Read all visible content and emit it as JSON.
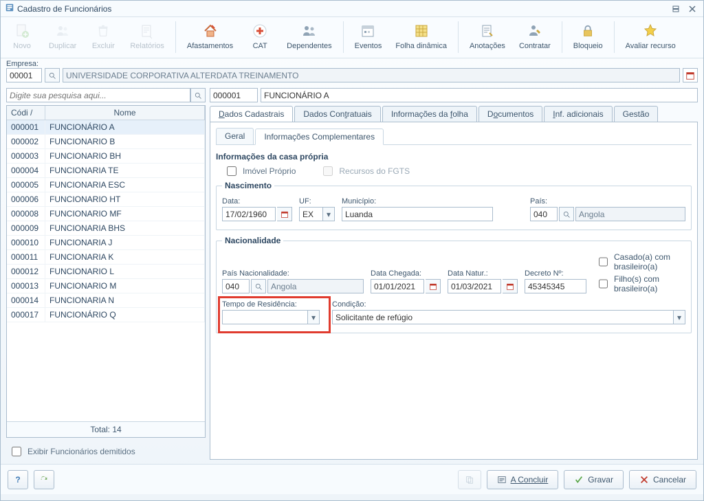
{
  "window": {
    "title": "Cadastro de Funcionários"
  },
  "toolbar": {
    "novo": "Novo",
    "duplicar": "Duplicar",
    "excluir": "Excluir",
    "relatorios": "Relatórios",
    "afastamentos": "Afastamentos",
    "cat": "CAT",
    "dependentes": "Dependentes",
    "eventos": "Eventos",
    "folha": "Folha dinâmica",
    "anotacoes": "Anotações",
    "contratar": "Contratar",
    "bloqueio": "Bloqueio",
    "avaliar": "Avaliar recurso"
  },
  "empresa": {
    "label": "Empresa:",
    "code": "00001",
    "name": "UNIVERSIDADE CORPORATIVA ALTERDATA TREINAMENTO"
  },
  "search": {
    "placeholder": "Digite sua pesquisa aqui..."
  },
  "grid": {
    "headers": {
      "codigo": "Códi  /",
      "nome": "Nome"
    },
    "rows": [
      {
        "c": "000001",
        "n": "FUNCIONÁRIO A",
        "sel": true
      },
      {
        "c": "000002",
        "n": "FUNCIONARIO B"
      },
      {
        "c": "000003",
        "n": "FUNCIONARIO BH"
      },
      {
        "c": "000004",
        "n": "FUNCIONARIA TE"
      },
      {
        "c": "000005",
        "n": "FUNCIONARIA ESC"
      },
      {
        "c": "000006",
        "n": "FUNCIONARIO HT"
      },
      {
        "c": "000008",
        "n": "FUNCIONARIO MF"
      },
      {
        "c": "000009",
        "n": "FUNCIONARIA BHS"
      },
      {
        "c": "000010",
        "n": "FUNCIONARIA J"
      },
      {
        "c": "000011",
        "n": "FUNCIONARIA K"
      },
      {
        "c": "000012",
        "n": "FUNCIONARIO L"
      },
      {
        "c": "000013",
        "n": "FUNCIONARIO M"
      },
      {
        "c": "000014",
        "n": "FUNCIONARIA N"
      },
      {
        "c": "000017",
        "n": "FUNCIONÁRIO Q"
      }
    ],
    "total": "Total: 14"
  },
  "left": {
    "exibir_demitidos": "Exibir Funcionários demitidos"
  },
  "right": {
    "code": "000001",
    "name": "FUNCIONÁRIO A",
    "tabs": {
      "cadastrais": "Dados Cadastrais",
      "contratuais": "Dados Contratuais",
      "folha": "Informações da folha",
      "docs": "Documentos",
      "inf": "Inf. adicionais",
      "gestao": "Gestão"
    },
    "subtabs": {
      "geral": "Geral",
      "comp": "Informações Complementares"
    }
  },
  "casa": {
    "section": "Informações da casa própria",
    "imovel": "Imóvel Próprio",
    "fgts": "Recursos do FGTS"
  },
  "nascimento": {
    "section": "Nascimento",
    "data_lbl": "Data:",
    "data_val": "17/02/1960",
    "uf_lbl": "UF:",
    "uf_val": "EX",
    "mun_lbl": "Município:",
    "mun_val": "Luanda",
    "pais_lbl": "País:",
    "pais_code": "040",
    "pais_name": "Angola"
  },
  "nac": {
    "section": "Nacionalidade",
    "pais_lbl": "País Nacionalidade:",
    "pais_code": "040",
    "pais_name": "Angola",
    "chegada_lbl": "Data Chegada:",
    "chegada_val": "01/01/2021",
    "natur_lbl": "Data Natur.:",
    "natur_val": "01/03/2021",
    "decreto_lbl": "Decreto Nº:",
    "decreto_val": "45345345",
    "casado": "Casado(a) com brasileiro(a)",
    "filho": "Filho(s) com brasileiro(a)",
    "tempo_lbl": "Tempo de Residência:",
    "tempo_val": "",
    "cond_lbl": "Condição:",
    "cond_val": "Solicitante de refúgio"
  },
  "buttons": {
    "concluir": "A Concluir",
    "gravar": "Gravar",
    "cancelar": "Cancelar"
  }
}
